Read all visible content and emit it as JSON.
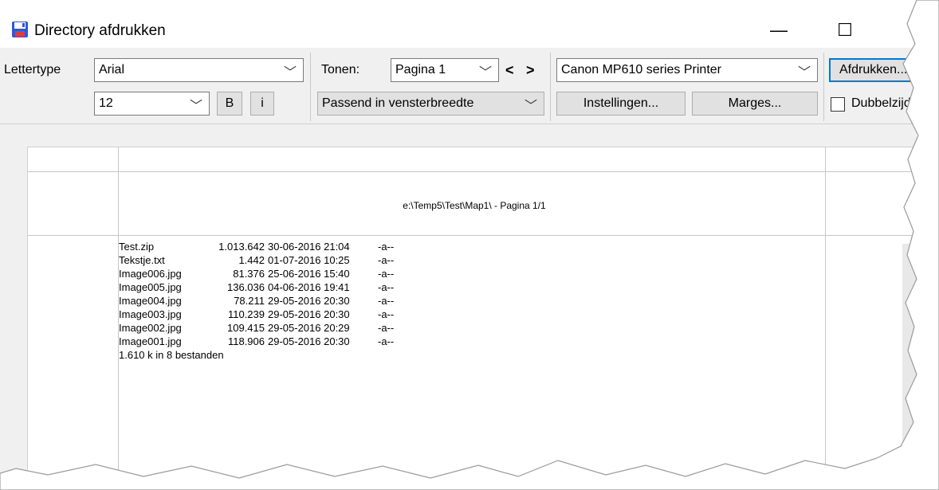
{
  "window": {
    "title": "Directory afdrukken",
    "minimize_glyph": "—",
    "maximize_glyph": "☐"
  },
  "toolbar": {
    "font_label": "Lettertype",
    "font_value": "Arial",
    "size_value": "12",
    "bold_label": "B",
    "italic_label": "i",
    "show_label": "Tonen:",
    "page_value": "Pagina 1",
    "prev_glyph": "<",
    "next_glyph": ">",
    "fit_value": "Passend in vensterbreedte",
    "printer_value": "Canon MP610 series Printer",
    "settings_label": "Instellingen...",
    "margins_label": "Marges...",
    "print_label": "Afdrukken...",
    "duplex_label": "Dubbelzijdig"
  },
  "preview": {
    "header": "e:\\Temp5\\Test\\Map1\\ - Pagina 1/1",
    "files": [
      {
        "name": "Test.zip",
        "size": "1.013.642",
        "date": "30-06-2016 21:04",
        "attr": "-a--"
      },
      {
        "name": "Tekstje.txt",
        "size": "1.442",
        "date": "01-07-2016 10:25",
        "attr": "-a--"
      },
      {
        "name": "Image006.jpg",
        "size": "81.376",
        "date": "25-06-2016 15:40",
        "attr": "-a--"
      },
      {
        "name": "Image005.jpg",
        "size": "136.036",
        "date": "04-06-2016 19:41",
        "attr": "-a--"
      },
      {
        "name": "Image004.jpg",
        "size": "78.211",
        "date": "29-05-2016 20:30",
        "attr": "-a--"
      },
      {
        "name": "Image003.jpg",
        "size": "110.239",
        "date": "29-05-2016 20:30",
        "attr": "-a--"
      },
      {
        "name": "Image002.jpg",
        "size": "109.415",
        "date": "29-05-2016 20:29",
        "attr": "-a--"
      },
      {
        "name": "Image001.jpg",
        "size": "118.906",
        "date": "29-05-2016 20:30",
        "attr": "-a--"
      }
    ],
    "summary": "1.610 k in 8 bestanden"
  }
}
